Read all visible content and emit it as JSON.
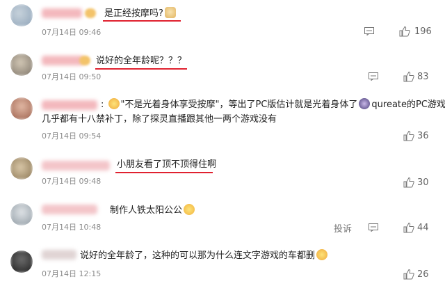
{
  "comments": [
    {
      "text": "是正经按摩吗?",
      "emoji": "doge-emoji",
      "date": "07月14日 09:46",
      "likes": "196"
    },
    {
      "text": "说好的全年龄呢？？？",
      "date": "07月14日 09:50",
      "likes": "83"
    },
    {
      "text_part1": ": ",
      "text_part2": "\"不是光着身体享受按摩\"，等出了PC版估计就是光着身体了",
      "text_part3": "qureate的PC游戏",
      "text_line2": "几乎都有十八禁补丁，除了探灵直播跟其他一两个游戏没有",
      "date": "07月14日 09:54",
      "likes": "36"
    },
    {
      "text": "小朋友看了顶不顶得住啊",
      "date": "07月14日 09:48",
      "likes": "30"
    },
    {
      "text": "制作人铁太阳公公",
      "emoji": "clap-emoji",
      "date": "07月14日 10:48",
      "report": "投诉",
      "likes": "44"
    },
    {
      "text": "说好的全年龄了，这种的可以那为什么连文字游戏的车都删",
      "emoji": "cry-emoji",
      "date": "07月14日 12:15",
      "likes": "26"
    }
  ],
  "colors": {
    "underline": "#e0212f",
    "meta": "#8a8a8a"
  }
}
